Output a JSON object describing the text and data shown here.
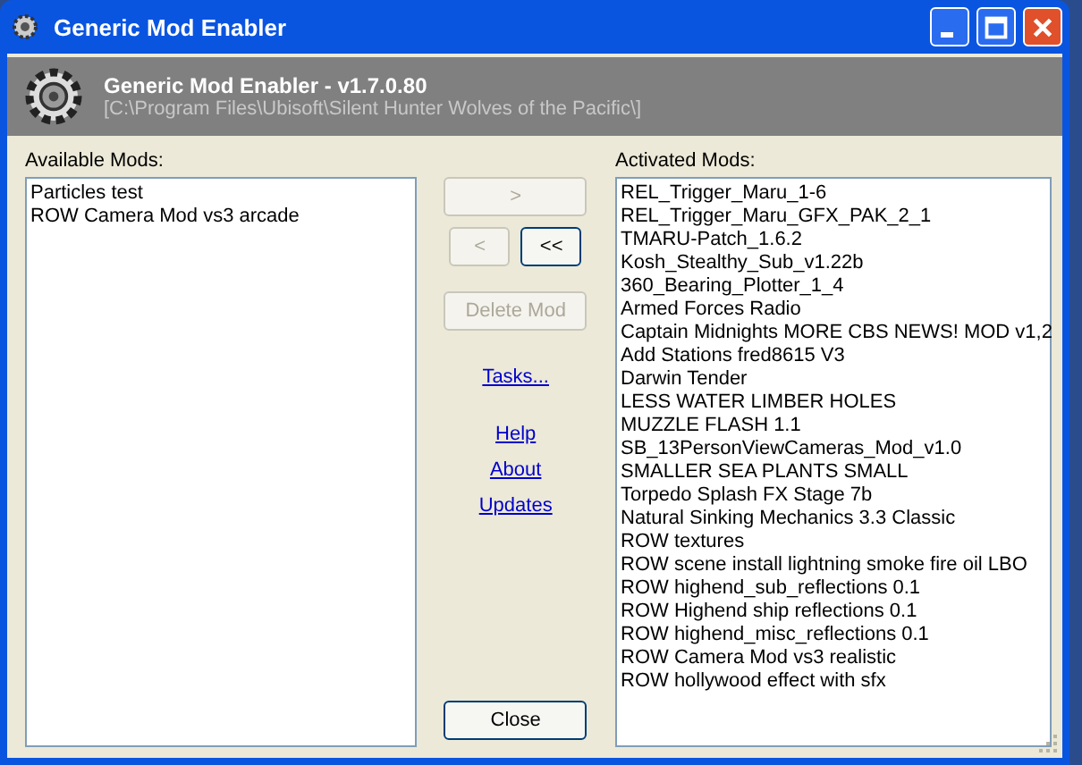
{
  "window": {
    "title": "Generic Mod Enabler"
  },
  "header": {
    "title": "Generic Mod Enabler - v1.7.0.80",
    "path": "[C:\\Program Files\\Ubisoft\\Silent Hunter Wolves of the Pacific\\]"
  },
  "available": {
    "label": "Available Mods:",
    "items": [
      "Particles test",
      "ROW Camera Mod vs3 arcade"
    ]
  },
  "buttons": [
    {
      "label": ">",
      "disabled": true,
      "kind": "wide"
    },
    {
      "label": "<",
      "disabled": true,
      "kind": "half"
    },
    {
      "label": "<<",
      "disabled": false,
      "kind": "half"
    },
    {
      "label": "Delete Mod",
      "disabled": true,
      "kind": "wide"
    }
  ],
  "links": [
    "Tasks...",
    "Help",
    "About",
    "Updates"
  ],
  "close": {
    "label": "Close"
  },
  "activated": {
    "label": "Activated Mods:",
    "items": [
      "REL_Trigger_Maru_1-6",
      "REL_Trigger_Maru_GFX_PAK_2_1",
      "TMARU-Patch_1.6.2",
      "Kosh_Stealthy_Sub_v1.22b",
      "360_Bearing_Plotter_1_4",
      "Armed Forces Radio",
      "Captain Midnights MORE CBS NEWS! MOD v1,2",
      "Add Stations fred8615 V3",
      "Darwin Tender",
      "LESS WATER LIMBER HOLES",
      "MUZZLE FLASH 1.1",
      "SB_13PersonViewCameras_Mod_v1.0",
      "SMALLER SEA PLANTS SMALL",
      "Torpedo Splash FX Stage 7b",
      "Natural Sinking Mechanics 3.3 Classic",
      "ROW textures",
      "ROW scene install lightning smoke fire oil LBO",
      "ROW highend_sub_reflections 0.1",
      "ROW Highend ship reflections 0.1",
      "ROW highend_misc_reflections 0.1",
      "ROW Camera Mod vs3 realistic",
      "ROW hollywood effect with sfx"
    ]
  }
}
